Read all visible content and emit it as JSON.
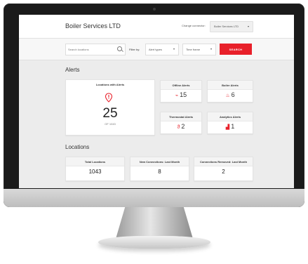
{
  "app": {
    "brand": "Boiler Services LTD",
    "connector_label": "Change connector:",
    "connector_value": "Boiler Services LTD"
  },
  "filters": {
    "search_placeholder": "Search locations",
    "filter_label": "Filter by:",
    "alert_type": "Alert types",
    "time_frame": "Time frame",
    "search_button": "SEARCH"
  },
  "alerts": {
    "title": "Alerts",
    "locations_with_alerts": {
      "label": "Locations with Alerts",
      "value": "25",
      "total_text": "OF 1043"
    },
    "offline": {
      "label": "Offline Alerts",
      "value": "15"
    },
    "boiler": {
      "label": "Boiler Alerts",
      "value": "6"
    },
    "thermostat": {
      "label": "Thermostat Alerts",
      "value": "2"
    },
    "analytics": {
      "label": "Analytics Alerts",
      "value": "1"
    }
  },
  "locations": {
    "title": "Locations",
    "total": {
      "label": "Total Locations",
      "value": "1043"
    },
    "new": {
      "label": "New Connections: Last Month",
      "value": "8"
    },
    "removed": {
      "label": "Connections Removed: Last Month",
      "value": "2"
    }
  },
  "colors": {
    "accent": "#e8202a",
    "background": "#ececec",
    "bezel": "#1a1a1a"
  },
  "icons": {
    "offline": "wifi-off-icon",
    "boiler": "flame-icon",
    "thermostat": "thermometer-icon",
    "analytics": "bar-chart-icon",
    "locations": "location-pin-alert-icon"
  }
}
